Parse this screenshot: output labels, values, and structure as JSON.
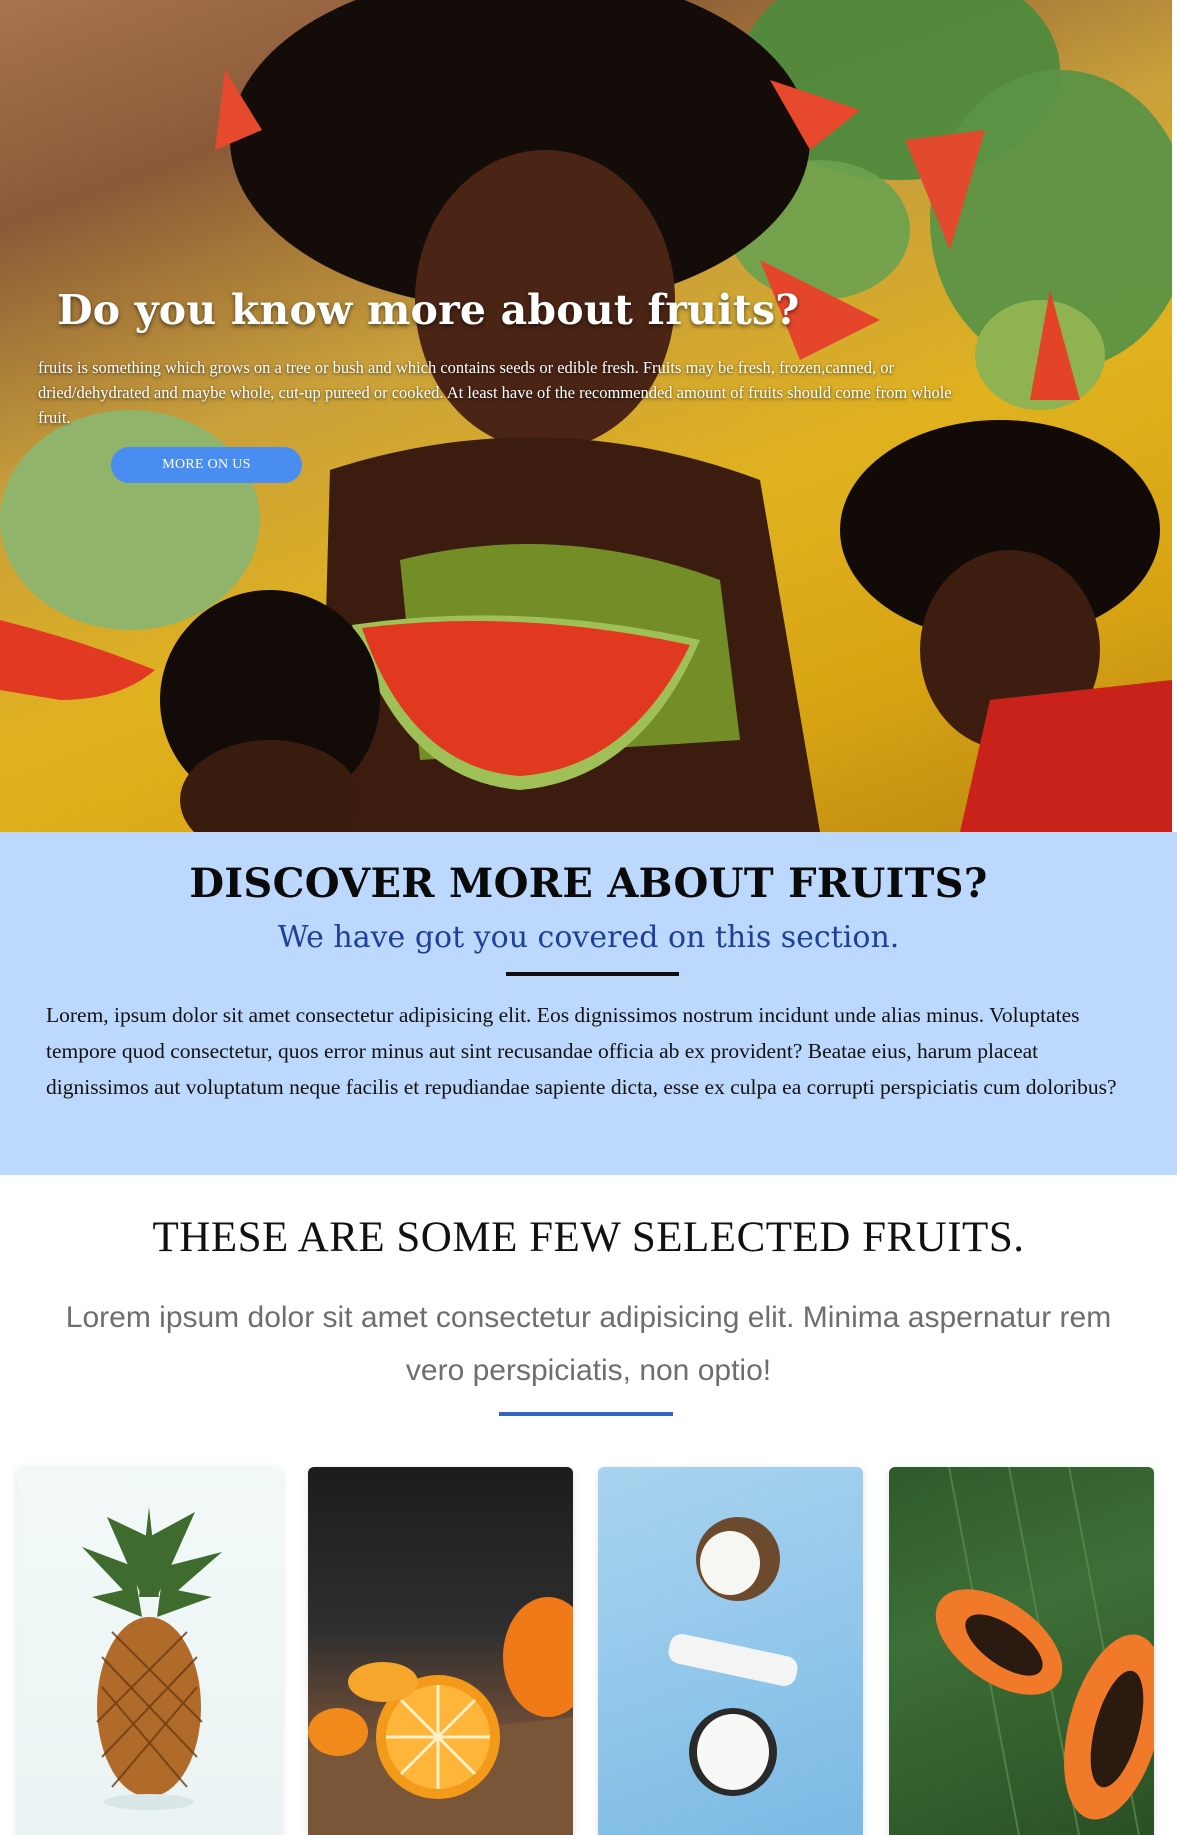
{
  "hero": {
    "title": "Do you know more about fruits?",
    "text": "fruits is something which grows on a tree or bush and which contains seeds or edible fresh. Fruits may be fresh, frozen,canned, or dried/dehydrated and maybe whole, cut-up pureed or cooked. At least have of the recommended amount of fruits should come from whole fruit.",
    "button_label": "MORE ON US"
  },
  "discover": {
    "title": "DISCOVER MORE ABOUT FRUITS?",
    "subtitle": "We have got you covered on this section.",
    "body": "Lorem, ipsum dolor sit amet consectetur adipisicing elit. Eos dignissimos nostrum incidunt unde alias minus. Voluptates tempore quod consectetur, quos error minus aut sint recusandae officia ab ex provident? Beatae eius, harum placeat dignissimos aut voluptatum neque facilis et repudiandae sapiente dicta, esse ex culpa ea corrupti perspiciatis cum doloribus?"
  },
  "selected": {
    "title": "THESE ARE SOME FEW SELECTED FRUITS.",
    "lead": "Lorem ipsum dolor sit amet consectetur adipisicing elit. Minima aspernatur rem vero perspiciatis, non optio!"
  },
  "cards": [
    {
      "icon": "pineapple-image"
    },
    {
      "icon": "orange-image"
    },
    {
      "icon": "coconut-image"
    },
    {
      "icon": "papaya-image"
    }
  ],
  "colors": {
    "button": "#4a8df0",
    "discover_bg": "#bcd8fc",
    "subtitle": "#1e3f9a",
    "accent_rule": "#3563c4"
  }
}
